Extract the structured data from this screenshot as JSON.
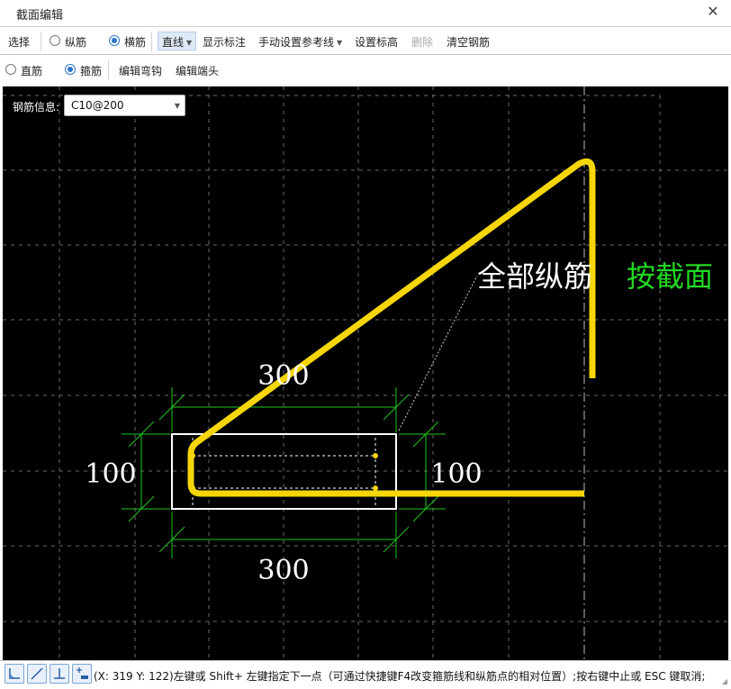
{
  "window": {
    "title": "截面编辑",
    "close_icon": "close-icon"
  },
  "toolbar1": {
    "select": "选择",
    "longitudinal": "纵筋",
    "transverse": "横筋",
    "line_mode": "直线",
    "show_dimension": "显示标注",
    "manual_reference": "手动设置参考线",
    "set_elevation": "设置标高",
    "delete": "删除",
    "clear_rebar": "清空钢筋",
    "selected_radio": "横筋"
  },
  "toolbar2": {
    "straight_bar": "直筋",
    "stirrup": "箍筋",
    "edit_hook": "编辑弯钩",
    "edit_end": "编辑端头",
    "selected_radio": "箍筋"
  },
  "canvas": {
    "rebar_info_label": "钢筋信息:",
    "rebar_info_value": "C10@200",
    "dim_top": "300",
    "dim_bottom": "300",
    "dim_left": "100",
    "dim_right": "100",
    "annotation_all_bars": "全部纵筋",
    "annotation_by_section": "按截面",
    "colors": {
      "background": "#000000",
      "rebar": "#f5d60a",
      "dimension": "#1ec81e",
      "section_outline": "#ffffff",
      "annotation_green": "#22d822",
      "grid": "#6a6a6a"
    }
  },
  "statusbar": {
    "text": "(X: 319 Y: 122)左键或 Shift+ 左键指定下一点（可通过快捷键F4改变箍筋线和纵筋点的相对位置）;按右键中止或 ESC 键取消;",
    "buttons": [
      "orthogonal-mode-icon",
      "line-mode-icon",
      "perpendicular-icon",
      "insert-point-icon"
    ]
  }
}
